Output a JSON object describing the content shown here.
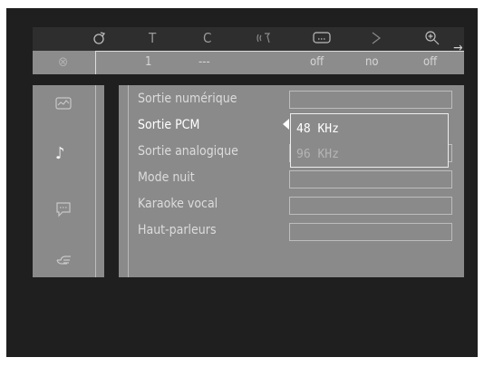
{
  "icon_bar": {
    "icons": [
      "player-icon",
      "title-icon",
      "chapter-icon",
      "audio-icon",
      "subtitle-icon",
      "angle-icon",
      "zoom-icon"
    ],
    "next_arrow": "→"
  },
  "value_bar": {
    "disc_glyph": "⊗",
    "title_value": "1",
    "chapter_value": "---",
    "audio_value": "off",
    "angle_value": "no",
    "zoom_value": "off"
  },
  "side_icons": [
    "picture-icon",
    "music-note-icon",
    "speech-bubble-icon",
    "hand-icon"
  ],
  "menu": {
    "items": [
      "Sortie numérique",
      "Sortie PCM",
      "Sortie analogique",
      "Mode nuit",
      "Karaoke vocal",
      "Haut-parleurs"
    ],
    "selected_index": 1
  },
  "dropdown": {
    "options": [
      "48 KHz",
      "96 KHz"
    ],
    "selected": "48 KHz"
  },
  "colors": {
    "background": "#1f1f1f",
    "panel": "#8a8a8a",
    "highlight": "#ffffff"
  }
}
